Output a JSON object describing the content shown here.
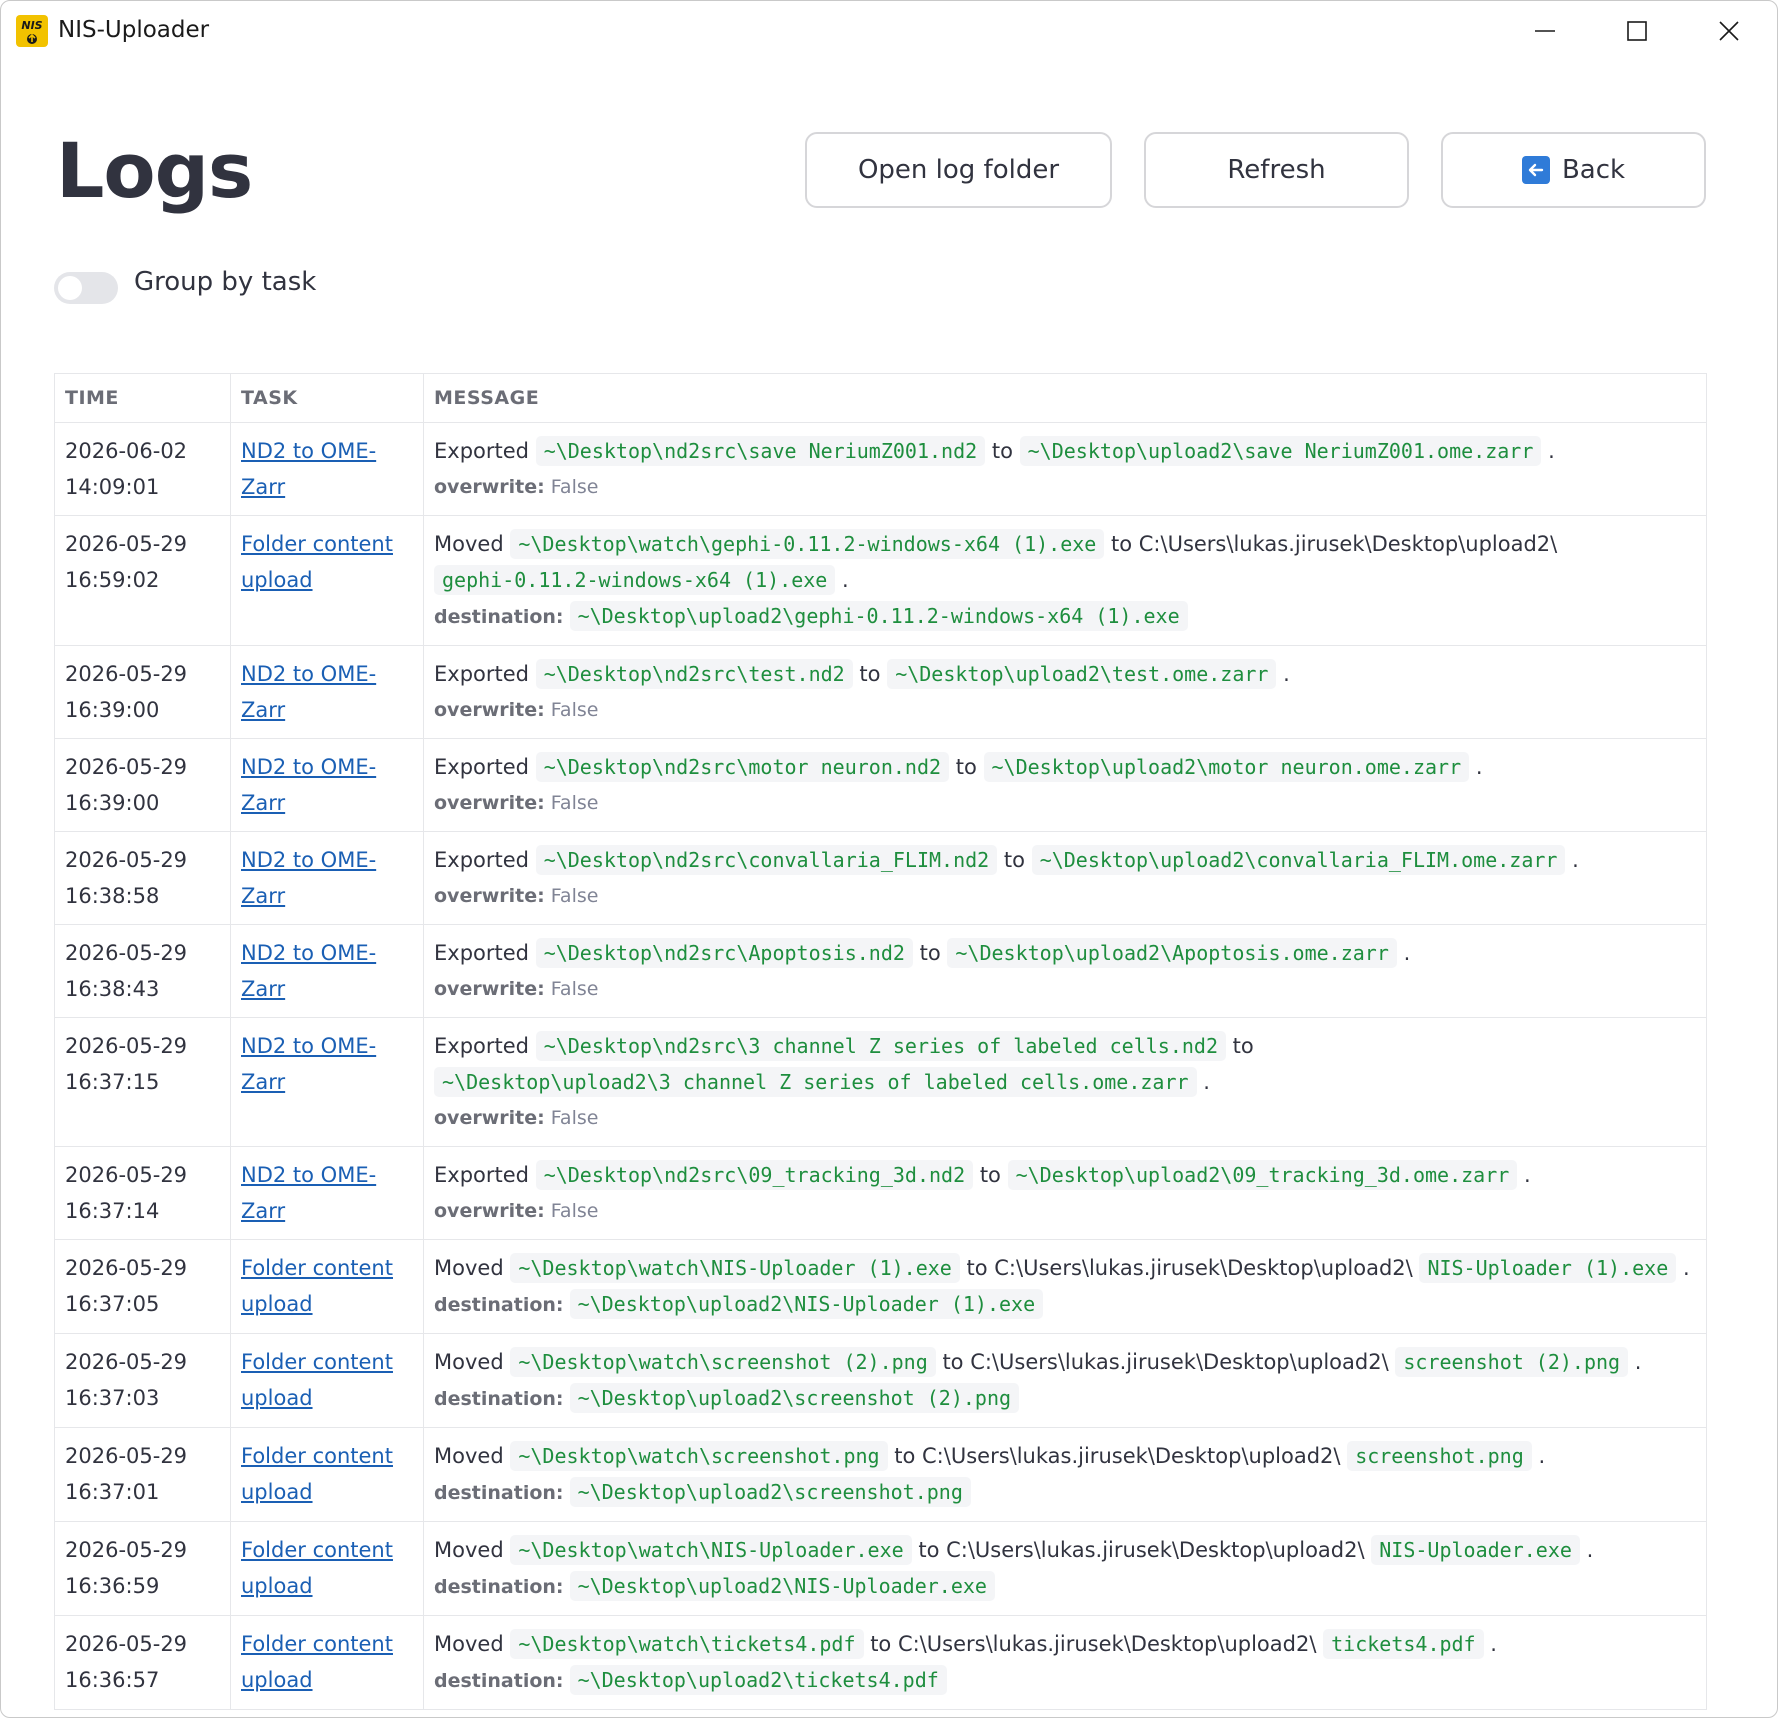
{
  "window": {
    "title": "NIS-Uploader",
    "icon_text": "NIS"
  },
  "header": {
    "title": "Logs",
    "open_log_folder": "Open log folder",
    "refresh": "Refresh",
    "back": "Back"
  },
  "toggle": {
    "label": "Group by task",
    "checked": false
  },
  "table": {
    "headers": {
      "time": "TIME",
      "task": "TASK",
      "message": "MESSAGE"
    },
    "rows": [
      {
        "date": "2026-06-02",
        "time": "14:09:01",
        "task": "ND2 to OME-Zarr",
        "verb": "Exported",
        "src": "~\\Desktop\\nd2src\\save NeriumZ001.nd2",
        "mid": "to",
        "dst": "~\\Desktop\\upload2\\save NeriumZ001.ome.zarr",
        "end": ".",
        "meta_key": "overwrite:",
        "meta_val": "False"
      },
      {
        "date": "2026-05-29",
        "time": "16:59:02",
        "task": "Folder content upload",
        "verb": "Moved",
        "src": "~\\Desktop\\watch\\gephi-0.11.2-windows-x64 (1).exe",
        "mid": "to C:\\Users\\lukas.jirusek\\Desktop\\upload2\\",
        "dst": "gephi-0.11.2-windows-x64 (1).exe",
        "end": ".",
        "meta_key": "destination:",
        "meta_val": "~\\Desktop\\upload2\\gephi-0.11.2-windows-x64 (1).exe"
      },
      {
        "date": "2026-05-29",
        "time": "16:39:00",
        "task": "ND2 to OME-Zarr",
        "verb": "Exported",
        "src": "~\\Desktop\\nd2src\\test.nd2",
        "mid": "to",
        "dst": "~\\Desktop\\upload2\\test.ome.zarr",
        "end": ".",
        "meta_key": "overwrite:",
        "meta_val": "False"
      },
      {
        "date": "2026-05-29",
        "time": "16:39:00",
        "task": "ND2 to OME-Zarr",
        "verb": "Exported",
        "src": "~\\Desktop\\nd2src\\motor neuron.nd2",
        "mid": "to",
        "dst": "~\\Desktop\\upload2\\motor neuron.ome.zarr",
        "end": ".",
        "meta_key": "overwrite:",
        "meta_val": "False"
      },
      {
        "date": "2026-05-29",
        "time": "16:38:58",
        "task": "ND2 to OME-Zarr",
        "verb": "Exported",
        "src": "~\\Desktop\\nd2src\\convallaria_FLIM.nd2",
        "mid": "to",
        "dst": "~\\Desktop\\upload2\\convallaria_FLIM.ome.zarr",
        "end": ".",
        "meta_key": "overwrite:",
        "meta_val": "False"
      },
      {
        "date": "2026-05-29",
        "time": "16:38:43",
        "task": "ND2 to OME-Zarr",
        "verb": "Exported",
        "src": "~\\Desktop\\nd2src\\Apoptosis.nd2",
        "mid": "to",
        "dst": "~\\Desktop\\upload2\\Apoptosis.ome.zarr",
        "end": ".",
        "meta_key": "overwrite:",
        "meta_val": "False"
      },
      {
        "date": "2026-05-29",
        "time": "16:37:15",
        "task": "ND2 to OME-Zarr",
        "verb": "Exported",
        "src": "~\\Desktop\\nd2src\\3 channel Z series of labeled cells.nd2",
        "mid": "to",
        "dst": "~\\Desktop\\upload2\\3 channel Z series of labeled cells.ome.zarr",
        "end": ".",
        "meta_key": "overwrite:",
        "meta_val": "False"
      },
      {
        "date": "2026-05-29",
        "time": "16:37:14",
        "task": "ND2 to OME-Zarr",
        "verb": "Exported",
        "src": "~\\Desktop\\nd2src\\09_tracking_3d.nd2",
        "mid": "to",
        "dst": "~\\Desktop\\upload2\\09_tracking_3d.ome.zarr",
        "end": ".",
        "meta_key": "overwrite:",
        "meta_val": "False"
      },
      {
        "date": "2026-05-29",
        "time": "16:37:05",
        "task": "Folder content upload",
        "verb": "Moved",
        "src": "~\\Desktop\\watch\\NIS-Uploader (1).exe",
        "mid": "to C:\\Users\\lukas.jirusek\\Desktop\\upload2\\",
        "dst": "NIS-Uploader (1).exe",
        "end": ".",
        "meta_key": "destination:",
        "meta_val": "~\\Desktop\\upload2\\NIS-Uploader (1).exe"
      },
      {
        "date": "2026-05-29",
        "time": "16:37:03",
        "task": "Folder content upload",
        "verb": "Moved",
        "src": "~\\Desktop\\watch\\screenshot (2).png",
        "mid": "to C:\\Users\\lukas.jirusek\\Desktop\\upload2\\",
        "dst": "screenshot (2).png",
        "end": ".",
        "meta_key": "destination:",
        "meta_val": "~\\Desktop\\upload2\\screenshot (2).png"
      },
      {
        "date": "2026-05-29",
        "time": "16:37:01",
        "task": "Folder content upload",
        "verb": "Moved",
        "src": "~\\Desktop\\watch\\screenshot.png",
        "mid": "to C:\\Users\\lukas.jirusek\\Desktop\\upload2\\",
        "dst": "screenshot.png",
        "end": ".",
        "meta_key": "destination:",
        "meta_val": "~\\Desktop\\upload2\\screenshot.png"
      },
      {
        "date": "2026-05-29",
        "time": "16:36:59",
        "task": "Folder content upload",
        "verb": "Moved",
        "src": "~\\Desktop\\watch\\NIS-Uploader.exe",
        "mid": "to C:\\Users\\lukas.jirusek\\Desktop\\upload2\\",
        "dst": "NIS-Uploader.exe",
        "end": ".",
        "meta_key": "destination:",
        "meta_val": "~\\Desktop\\upload2\\NIS-Uploader.exe"
      },
      {
        "date": "2026-05-29",
        "time": "16:36:57",
        "task": "Folder content upload",
        "verb": "Moved",
        "src": "~\\Desktop\\watch\\tickets4.pdf",
        "mid": "to C:\\Users\\lukas.jirusek\\Desktop\\upload2\\",
        "dst": "tickets4.pdf",
        "end": ".",
        "meta_key": "destination:",
        "meta_val": "~\\Desktop\\upload2\\tickets4.pdf"
      }
    ]
  },
  "colors": {
    "link": "#1a5fb4",
    "code": "#1e8e3e",
    "text": "#31333f"
  }
}
